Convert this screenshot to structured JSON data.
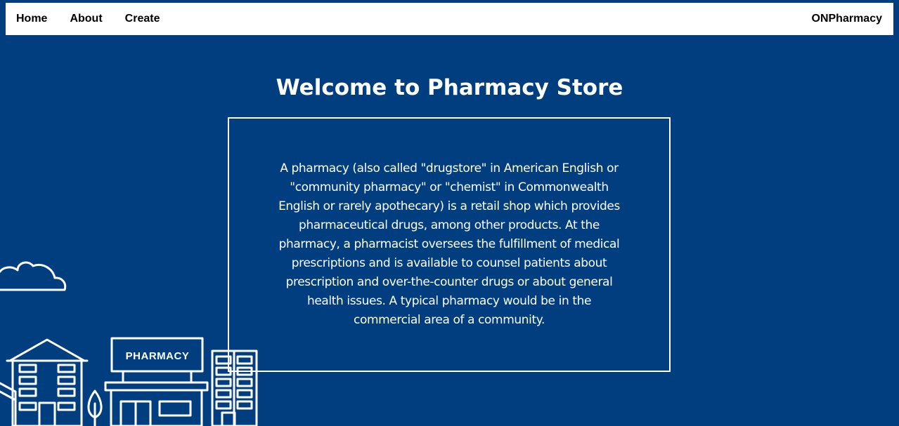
{
  "nav": {
    "links": [
      {
        "label": "Home"
      },
      {
        "label": "About"
      },
      {
        "label": "Create"
      }
    ],
    "brand": "ONPharmacy"
  },
  "main": {
    "title": "Welcome to Pharmacy Store",
    "description": "A pharmacy (also called \"drugstore\" in American English or \"community pharmacy\" or \"chemist\" in Commonwealth English or rarely apothecary) is a retail shop which provides pharmaceutical drugs, among other products. At the pharmacy, a pharmacist oversees the fulfillment of medical prescriptions and is available to counsel patients about prescription and over-the-counter drugs or about general health issues. A typical pharmacy would be in the commercial area of a community."
  },
  "illustration": {
    "sign_label": "PHARMACY"
  },
  "colors": {
    "background": "#003e80",
    "navbar": "#ffffff",
    "text_light": "#ffffff"
  }
}
